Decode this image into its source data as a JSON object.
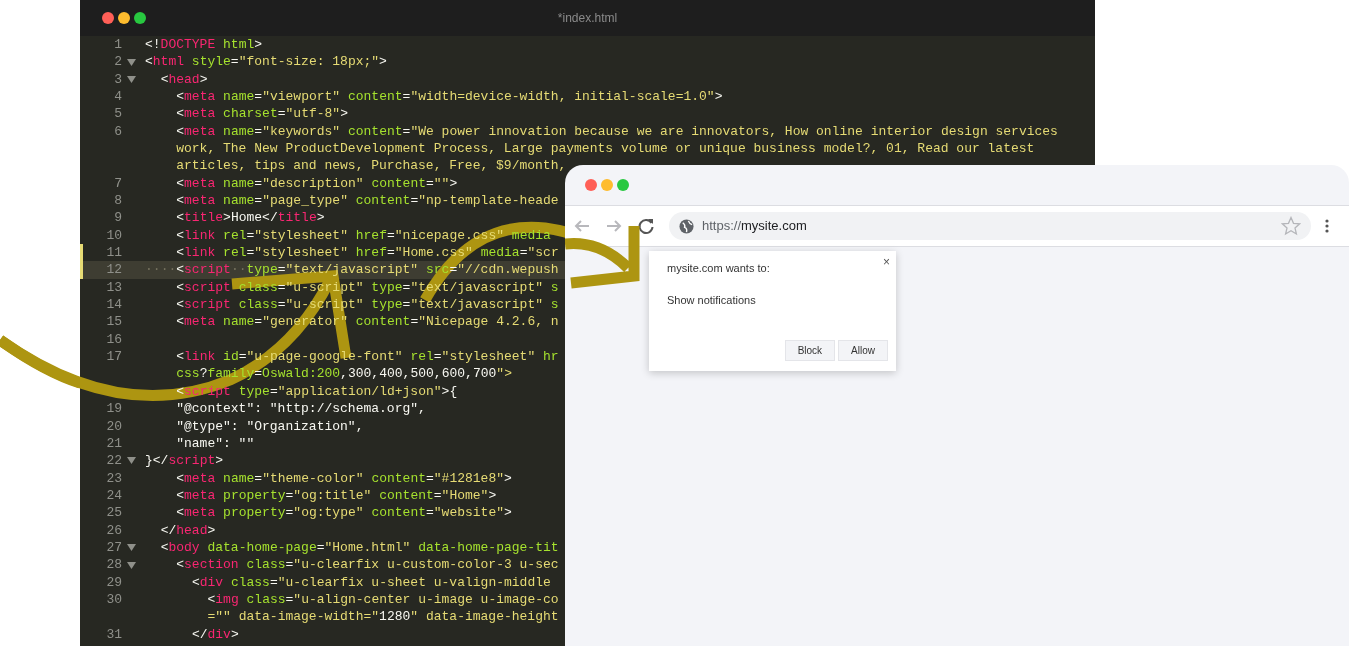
{
  "editor": {
    "title": "*index.html",
    "lines": [
      {
        "number": "1",
        "kind": "markup",
        "foldable": false,
        "modified": false,
        "selected": false,
        "rows": [
          "<!DOCTYPE html>"
        ]
      },
      {
        "number": "2",
        "kind": "markup",
        "foldable": true,
        "modified": false,
        "selected": false,
        "rows": [
          "<html style=\"font-size: 18px;\">"
        ]
      },
      {
        "number": "3",
        "kind": "markup",
        "foldable": true,
        "modified": false,
        "selected": false,
        "rows": [
          "  <head>"
        ]
      },
      {
        "number": "4",
        "kind": "markup",
        "foldable": false,
        "modified": false,
        "selected": false,
        "rows": [
          "    <meta name=\"viewport\" content=\"width=device-width, initial-scale=1.0\">"
        ]
      },
      {
        "number": "5",
        "kind": "markup",
        "foldable": false,
        "modified": false,
        "selected": false,
        "rows": [
          "    <meta charset=\"utf-8\">"
        ]
      },
      {
        "number": "6",
        "kind": "markup",
        "foldable": false,
        "modified": false,
        "selected": false,
        "rows": [
          "    <meta name=\"keywords\" content=\"We power innovation because we are innovators, How online interior design services",
          "    work, The New ProductDevelopment Process, Large payments volume or unique business model?, 01, Read our latest",
          "    articles, tips and news, Purchase, Free, $9/month,"
        ]
      },
      {
        "number": "7",
        "kind": "markup",
        "foldable": false,
        "modified": false,
        "selected": false,
        "rows": [
          "    <meta name=\"description\" content=\"\">"
        ]
      },
      {
        "number": "8",
        "kind": "markup",
        "foldable": false,
        "modified": false,
        "selected": false,
        "rows": [
          "    <meta name=\"page_type\" content=\"np-template-heade"
        ]
      },
      {
        "number": "9",
        "kind": "markup",
        "foldable": false,
        "modified": false,
        "selected": false,
        "rows": [
          "    <title>Home</title>"
        ]
      },
      {
        "number": "10",
        "kind": "markup",
        "foldable": false,
        "modified": false,
        "selected": false,
        "rows": [
          "    <link rel=\"stylesheet\" href=\"nicepage.css\" media"
        ]
      },
      {
        "number": "11",
        "kind": "markup",
        "foldable": false,
        "modified": true,
        "selected": false,
        "rows": [
          "    <link rel=\"stylesheet\" href=\"Home.css\" media=\"scr"
        ]
      },
      {
        "number": "12",
        "kind": "markup",
        "foldable": false,
        "modified": true,
        "selected": true,
        "rows": [
          "····<script··type=\"text/javascript\" src=\"//cdn.wepush"
        ]
      },
      {
        "number": "13",
        "kind": "markup",
        "foldable": false,
        "modified": false,
        "selected": false,
        "rows": [
          "    <script class=\"u-script\" type=\"text/javascript\" s"
        ]
      },
      {
        "number": "14",
        "kind": "markup",
        "foldable": false,
        "modified": false,
        "selected": false,
        "rows": [
          "    <script class=\"u-script\" type=\"text/javascript\" s"
        ]
      },
      {
        "number": "15",
        "kind": "markup",
        "foldable": false,
        "modified": false,
        "selected": false,
        "rows": [
          "    <meta name=\"generator\" content=\"Nicepage 4.2.6, n"
        ]
      },
      {
        "number": "16",
        "kind": "markup",
        "foldable": false,
        "modified": false,
        "selected": false
      },
      {
        "number": "17",
        "kind": "markup",
        "foldable": false,
        "modified": false,
        "selected": false,
        "rows": [
          "    <link id=\"u-page-google-font\" rel=\"stylesheet\" hr",
          "    css?family=Oswald:200,300,400,500,600,700\">"
        ]
      },
      {
        "kind": "markup",
        "foldable": false,
        "modified": false,
        "selected": false,
        "rows": [
          "    <script type=\"application/ld+json\">{"
        ]
      },
      {
        "number": "19",
        "kind": "plain",
        "foldable": false,
        "modified": false,
        "selected": false,
        "rows": [
          "    \"@context\": \"http://schema.org\","
        ]
      },
      {
        "number": "20",
        "kind": "plain",
        "foldable": false,
        "modified": false,
        "selected": false,
        "rows": [
          "    \"@type\": \"Organization\","
        ]
      },
      {
        "number": "21",
        "kind": "plain",
        "foldable": false,
        "modified": false,
        "selected": false,
        "rows": [
          "    \"name\": \"\""
        ]
      },
      {
        "number": "22",
        "kind": "markup",
        "foldable": true,
        "modified": false,
        "selected": false,
        "rows": [
          "}</script>"
        ]
      },
      {
        "number": "23",
        "kind": "markup",
        "foldable": false,
        "modified": false,
        "selected": false,
        "rows": [
          "    <meta name=\"theme-color\" content=\"#1281e8\">"
        ]
      },
      {
        "number": "24",
        "kind": "markup",
        "foldable": false,
        "modified": false,
        "selected": false,
        "rows": [
          "    <meta property=\"og:title\" content=\"Home\">"
        ]
      },
      {
        "number": "25",
        "kind": "markup",
        "foldable": false,
        "modified": false,
        "selected": false,
        "rows": [
          "    <meta property=\"og:type\" content=\"website\">"
        ]
      },
      {
        "number": "26",
        "kind": "markup",
        "foldable": false,
        "modified": false,
        "selected": false,
        "rows": [
          "  </head>"
        ]
      },
      {
        "number": "27",
        "kind": "markup",
        "foldable": true,
        "modified": false,
        "selected": false,
        "rows": [
          "  <body data-home-page=\"Home.html\" data-home-page-tit"
        ]
      },
      {
        "number": "28",
        "kind": "markup",
        "foldable": true,
        "modified": false,
        "selected": false,
        "rows": [
          "    <section class=\"u-clearfix u-custom-color-3 u-sec"
        ]
      },
      {
        "number": "29",
        "kind": "markup",
        "foldable": false,
        "modified": false,
        "selected": false,
        "rows": [
          "      <div class=\"u-clearfix u-sheet u-valign-middle"
        ]
      },
      {
        "number": "30",
        "kind": "markup",
        "foldable": false,
        "modified": false,
        "selected": false,
        "rows": [
          "        <img class=\"u-align-center u-image u-image-co",
          "        =\"\" data-image-width=\"1280\" data-image-height"
        ]
      },
      {
        "number": "31",
        "kind": "markup",
        "foldable": false,
        "modified": false,
        "selected": false,
        "rows": [
          "      </div>"
        ]
      }
    ]
  },
  "browser": {
    "url_scheme": "https://",
    "url_host": "mysite.com",
    "popup": {
      "title": "mysite.com wants to:",
      "message": "Show notifications",
      "close": "×",
      "buttons": [
        "Block",
        "Allow"
      ]
    }
  }
}
